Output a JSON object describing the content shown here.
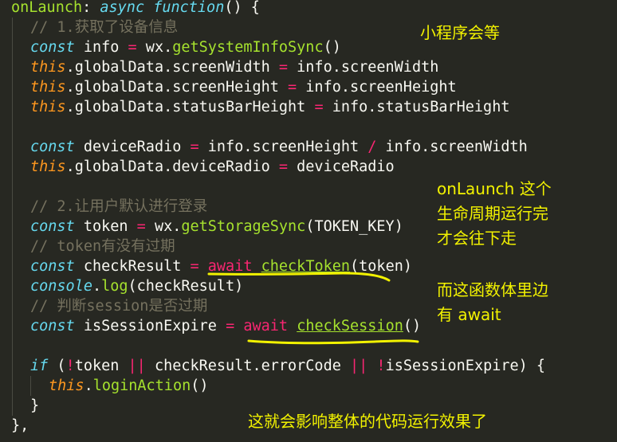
{
  "code": {
    "l1": {
      "name": "onLaunch",
      "colon": ": ",
      "async": "async",
      "sp": " ",
      "fn": "function",
      "rest": "() {"
    },
    "l2": {
      "comment": "// 1.获取了设备信息"
    },
    "l3": {
      "kw": "const",
      "a": " info ",
      "op": "=",
      "b": " wx.",
      "call": "getSystemInfoSync",
      "c": "()"
    },
    "l4": {
      "th": "this",
      "a": ".globalData.screenWidth ",
      "op": "=",
      "b": " info.screenWidth"
    },
    "l5": {
      "th": "this",
      "a": ".globalData.screenHeight ",
      "op": "=",
      "b": " info.screenHeight"
    },
    "l6": {
      "th": "this",
      "a": ".globalData.statusBarHeight ",
      "op": "=",
      "b": " info.statusBarHeight"
    },
    "l8": {
      "kw": "const",
      "a": " deviceRadio ",
      "op": "=",
      "b": " info.screenHeight ",
      "op2": "/",
      "c": " info.screenWidth"
    },
    "l9": {
      "th": "this",
      "a": ".globalData.deviceRadio ",
      "op": "=",
      "b": " deviceRadio"
    },
    "l11": {
      "comment": "// 2.让用户默认进行登录"
    },
    "l12": {
      "kw": "const",
      "a": " token ",
      "op": "=",
      "b": " wx.",
      "call": "getStorageSync",
      "c": "(TOKEN_KEY)"
    },
    "l13": {
      "comment": "// token有没有过期"
    },
    "l14": {
      "kw": "const",
      "a": " checkResult ",
      "op": "=",
      "sp": " ",
      "aw": "await",
      "sp2": " ",
      "call": "checkToken",
      "c": "(token)"
    },
    "l15": {
      "kw": "console",
      "a": ".",
      "call": "log",
      "c": "(checkResult)"
    },
    "l16": {
      "comment": "// 判断session是否过期"
    },
    "l17": {
      "kw": "const",
      "a": " isSessionExpire ",
      "op": "=",
      "sp": " ",
      "aw": "await",
      "sp2": " ",
      "call": "checkSession",
      "c": "()"
    },
    "l19": {
      "kw": "if",
      "a": " (",
      "op": "!",
      "b": "token ",
      "op2": "||",
      "c": " checkResult.errorCode ",
      "op3": "||",
      "d": " ",
      "op4": "!",
      "e": "isSessionExpire) {"
    },
    "l20": {
      "th": "this",
      "a": ".",
      "call": "loginAction",
      "c": "()"
    },
    "l21": {
      "a": "}"
    },
    "l22": {
      "a": "},"
    }
  },
  "annotations": {
    "top_right": "小程序会等",
    "middle_1": "onLaunch 这个",
    "middle_2": "生命周期运行完",
    "middle_3": "才会往下走",
    "lower_1": "而这函数体里边",
    "lower_2": "有 await",
    "bottom": "这就会影响整体的代码运行效果了"
  },
  "colors": {
    "background": "#272822",
    "keyword": "#66D9EF",
    "this_keyword": "#FD971F",
    "function_name": "#A6E22E",
    "operator": "#F92672",
    "comment": "#75715E",
    "text": "#F8F8F2",
    "annotation": "#F2F200"
  }
}
